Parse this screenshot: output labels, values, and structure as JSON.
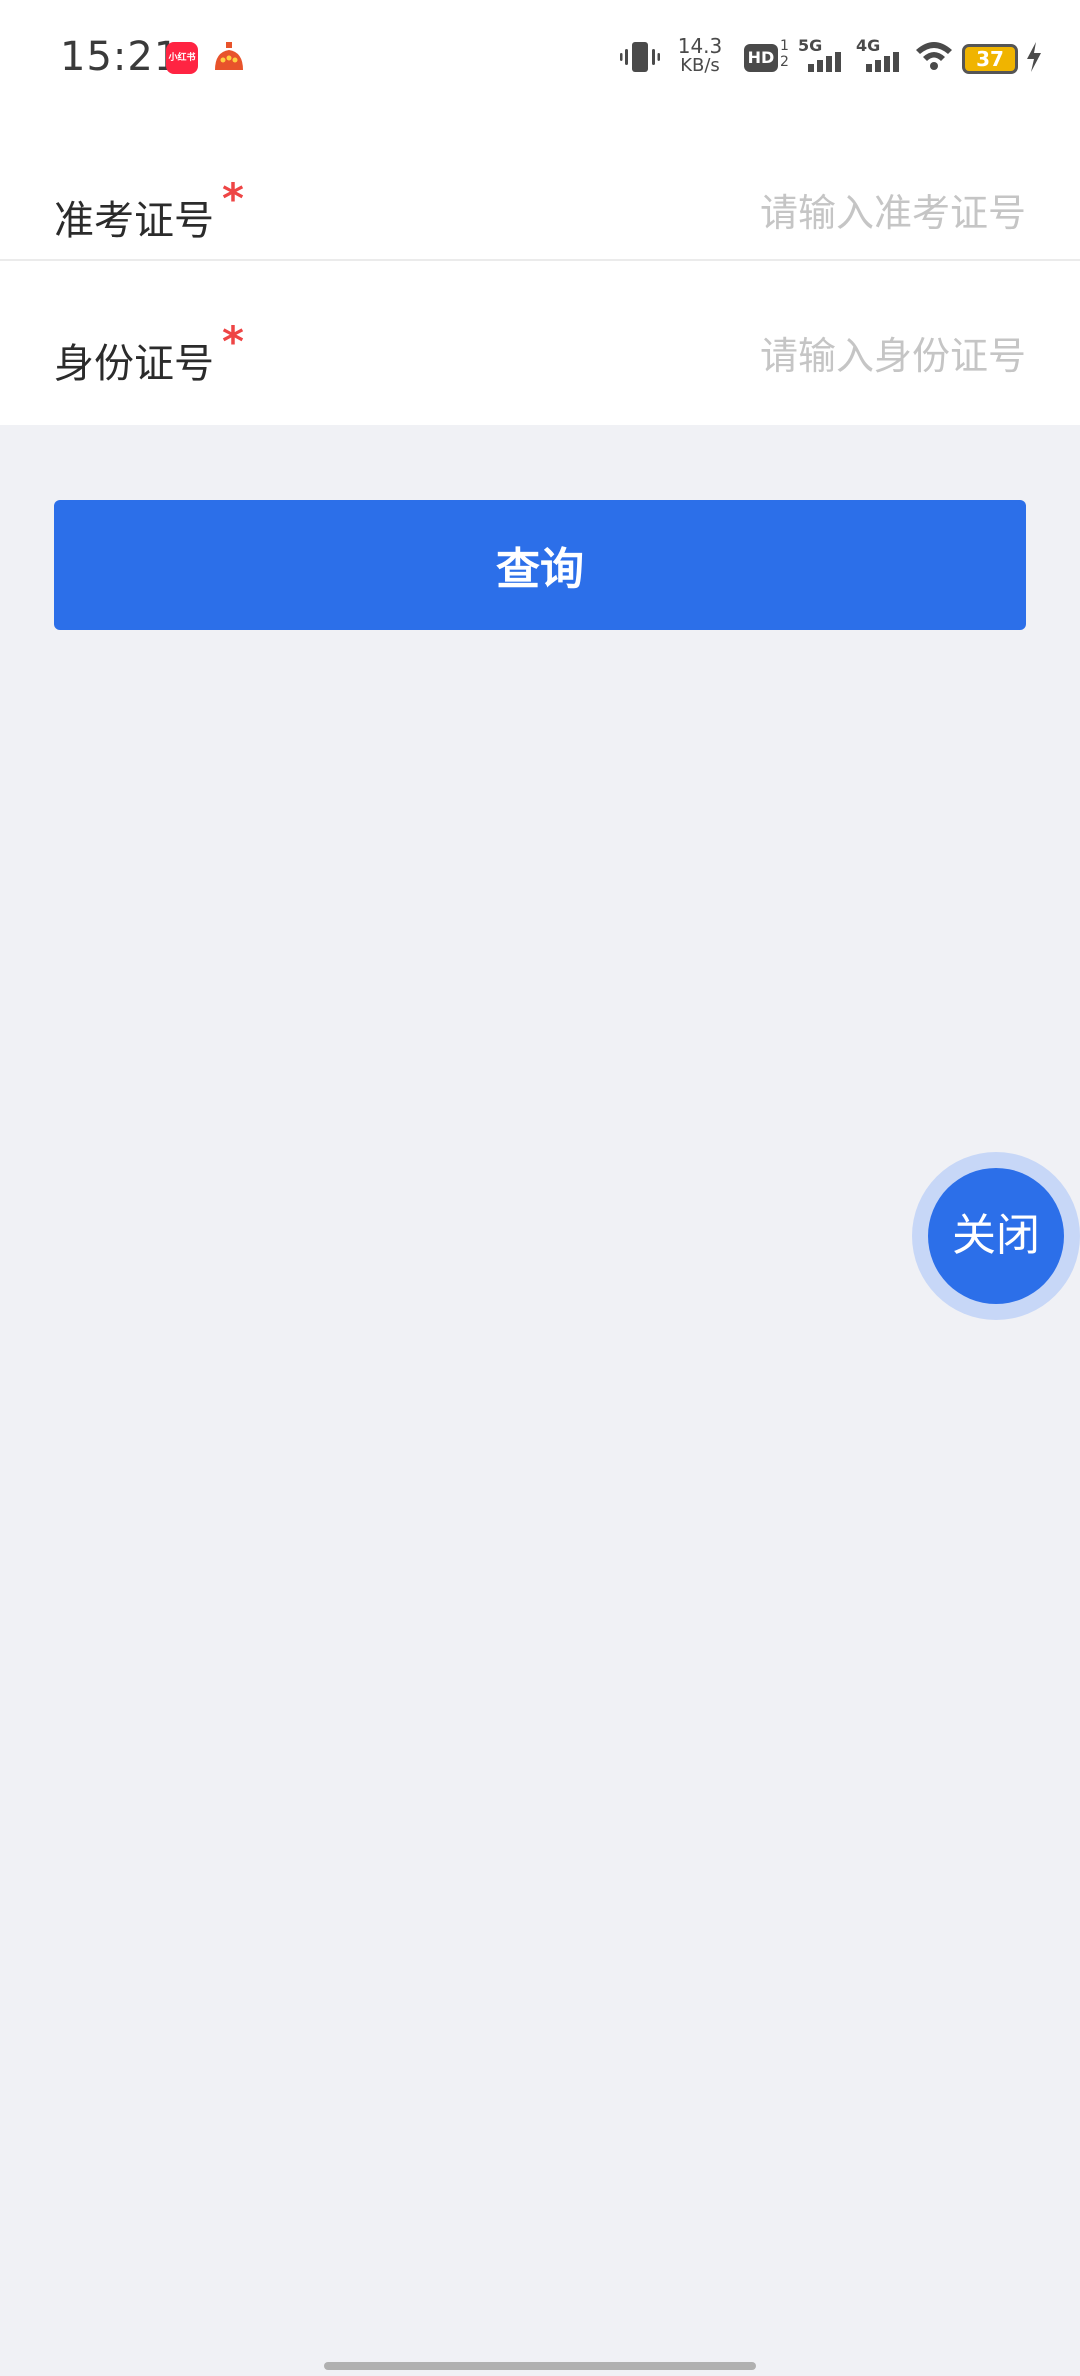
{
  "status_bar": {
    "time": "15:21",
    "app_badge_text": "小红书",
    "net_speed_value": "14.3",
    "net_speed_unit": "KB/s",
    "hd_label": "HD",
    "hd_sub": "1 2",
    "signal_1_label": "5G",
    "signal_2_label": "4G",
    "battery_level": "37"
  },
  "form": {
    "exam_number": {
      "label": "准考证号",
      "required_mark": "*",
      "placeholder": "请输入准考证号",
      "value": ""
    },
    "id_number": {
      "label": "身份证号",
      "required_mark": "*",
      "placeholder": "请输入身份证号",
      "value": ""
    }
  },
  "actions": {
    "query_label": "查询",
    "close_label": "关闭"
  },
  "colors": {
    "primary": "#2c6fe9",
    "required": "#ee4545",
    "page_bg": "#f0f1f5",
    "placeholder": "#c5c5c5"
  }
}
